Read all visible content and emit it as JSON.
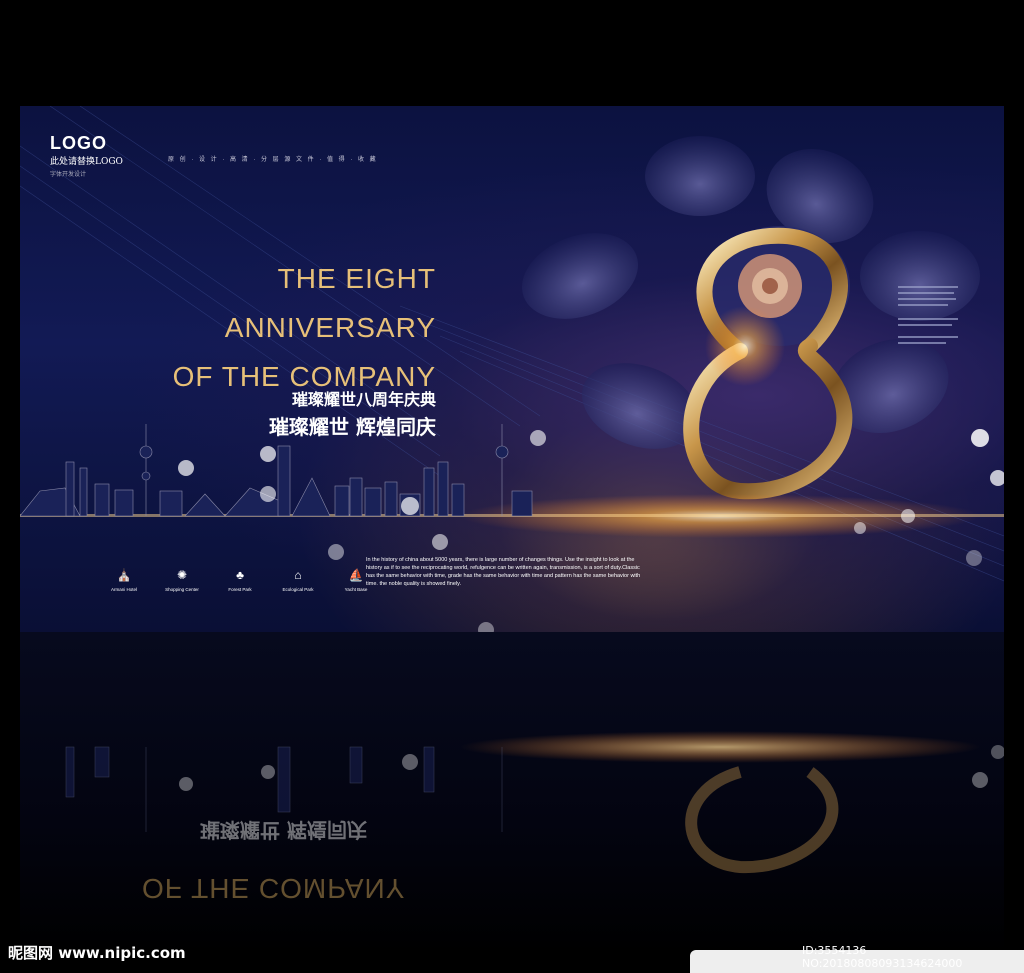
{
  "logo": {
    "title": "LOGO",
    "subtitle": "此处请替换LOGO",
    "caption": "字体开发设计"
  },
  "tagline": "原 创 · 设 计 · 高 清 · 分 层 源 文 件 · 值 得 · 收 藏",
  "headline": {
    "line1": "THE EIGHT",
    "line2": "ANNIVERSARY",
    "line3": "OF THE COMPANY"
  },
  "chinese": {
    "line1": "璀璨耀世八周年庆典",
    "line2": "璀璨耀世  辉煌同庆"
  },
  "facilities": [
    {
      "label": "Armani Hotel",
      "icon": "hotel-icon"
    },
    {
      "label": "Shopping Center",
      "icon": "shopping-icon"
    },
    {
      "label": "Forest Park",
      "icon": "tree-icon"
    },
    {
      "label": "Ecological Park",
      "icon": "pavilion-icon"
    },
    {
      "label": "Yacht Base",
      "icon": "sailboat-icon"
    }
  ],
  "paragraph": "In the history of china about 5000 years, there is large number of changes things. Use the insight to look at the history as if to see the reciprocating world, refulgence can be written again, transmission, is a sort of duty.Classic has the same behavior with time, grade has the same behavior with time and pattern has the same behavior with time. the noble quality is showed finely.",
  "watermark": {
    "site": "昵图网 www.nipic.com",
    "id": "ID:3554136 NO:20180808093134624000"
  },
  "colors": {
    "gold": "#e7c078",
    "navy": "#0c1240"
  }
}
